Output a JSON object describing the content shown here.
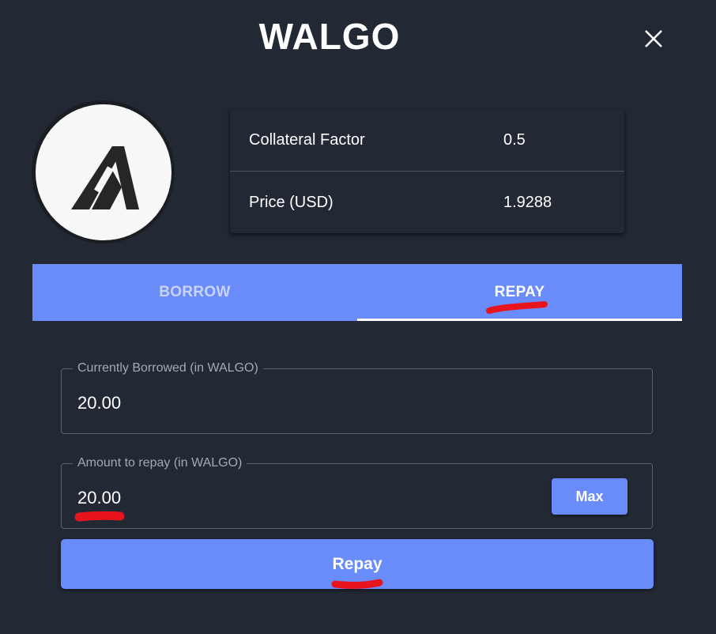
{
  "header": {
    "title": "WALGO",
    "close_icon": "close-icon"
  },
  "asset": {
    "logo_icon": "algorand-logo-icon"
  },
  "info": {
    "rows": [
      {
        "label": "Collateral Factor",
        "value": "0.5"
      },
      {
        "label": "Price (USD)",
        "value": "1.9288"
      }
    ]
  },
  "tabs": {
    "borrow_label": "BORROW",
    "repay_label": "REPAY",
    "active": "REPAY"
  },
  "form": {
    "borrowed_label": "Currently Borrowed (in WALGO)",
    "borrowed_value": "20.00",
    "repay_label": "Amount to repay (in WALGO)",
    "repay_value": "20.00",
    "max_label": "Max",
    "submit_label": "Repay"
  },
  "colors": {
    "background": "#222834",
    "accent": "#6a8cfb",
    "annotation": "#e8141c"
  }
}
